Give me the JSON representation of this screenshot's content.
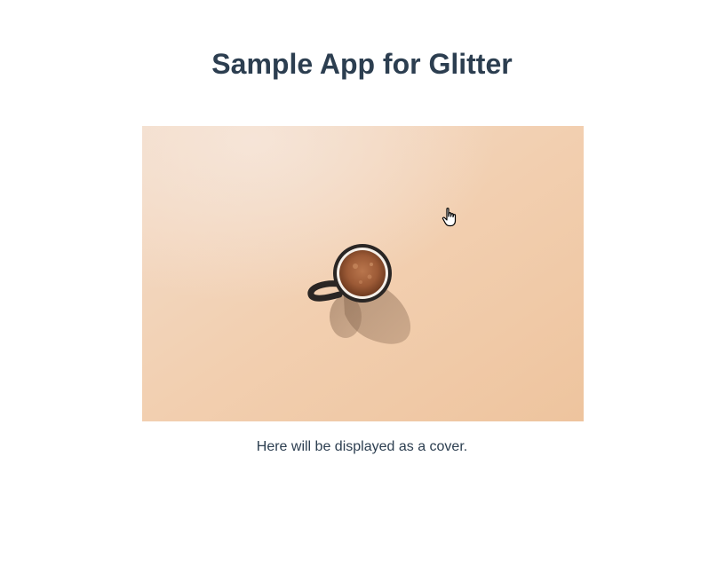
{
  "header": {
    "title": "Sample App for Glitter"
  },
  "cover": {
    "image_subject": "coffee cup on peach background",
    "caption": "Here will be displayed as a cover."
  },
  "colors": {
    "title_text": "#2c3e50",
    "caption_text": "#2c3e50",
    "cover_background": "#f2cfae"
  },
  "cursor": {
    "icon": "pointer-hand-icon"
  }
}
